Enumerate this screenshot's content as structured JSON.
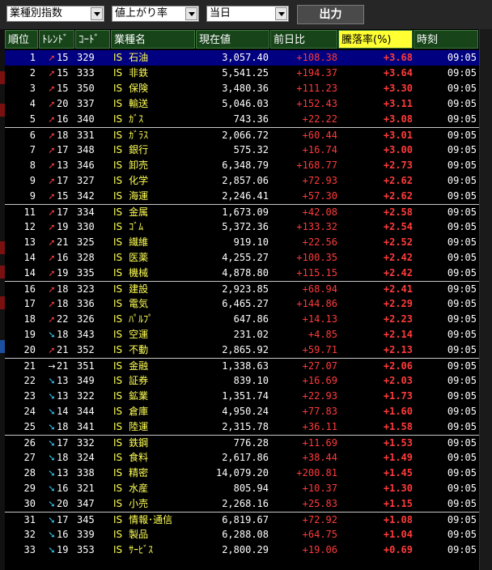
{
  "toolbar": {
    "category_select": "業種別指数",
    "sort_select": "値上がり率",
    "period_select": "当日",
    "output_button": "出力"
  },
  "columns": [
    "順位",
    "ﾄﾚﾝﾄﾞ",
    "ｺｰﾄﾞ",
    "業種名",
    "現在値",
    "前日比",
    "騰落率(%)",
    "時刻"
  ],
  "active_column": "騰落率(%)",
  "rows": [
    {
      "rank": "1",
      "trend_dir": "up",
      "trend": "15",
      "code": "329",
      "market": "IS",
      "name": "石油",
      "price": "3,057.40",
      "change": "+108.38",
      "rate": "+3.68",
      "time": "09:05"
    },
    {
      "rank": "2",
      "trend_dir": "up",
      "trend": "15",
      "code": "333",
      "market": "IS",
      "name": "非鉄",
      "price": "5,541.25",
      "change": "+194.37",
      "rate": "+3.64",
      "time": "09:05"
    },
    {
      "rank": "3",
      "trend_dir": "up",
      "trend": "15",
      "code": "350",
      "market": "IS",
      "name": "保険",
      "price": "3,480.36",
      "change": "+111.23",
      "rate": "+3.30",
      "time": "09:05"
    },
    {
      "rank": "4",
      "trend_dir": "up",
      "trend": "20",
      "code": "337",
      "market": "IS",
      "name": "輸送",
      "price": "5,046.03",
      "change": "+152.43",
      "rate": "+3.11",
      "time": "09:05"
    },
    {
      "rank": "5",
      "trend_dir": "up",
      "trend": "16",
      "code": "340",
      "market": "IS",
      "name": "ｶﾞｽ",
      "price": "743.36",
      "change": "+22.22",
      "rate": "+3.08",
      "time": "09:05"
    },
    {
      "rank": "6",
      "trend_dir": "up",
      "trend": "18",
      "code": "331",
      "market": "IS",
      "name": "ｶﾞﾗｽ",
      "price": "2,066.72",
      "change": "+60.44",
      "rate": "+3.01",
      "time": "09:05"
    },
    {
      "rank": "7",
      "trend_dir": "up",
      "trend": "17",
      "code": "348",
      "market": "IS",
      "name": "銀行",
      "price": "575.32",
      "change": "+16.74",
      "rate": "+3.00",
      "time": "09:05"
    },
    {
      "rank": "8",
      "trend_dir": "up",
      "trend": "13",
      "code": "346",
      "market": "IS",
      "name": "卸売",
      "price": "6,348.79",
      "change": "+168.77",
      "rate": "+2.73",
      "time": "09:05"
    },
    {
      "rank": "9",
      "trend_dir": "up",
      "trend": "17",
      "code": "327",
      "market": "IS",
      "name": "化学",
      "price": "2,857.06",
      "change": "+72.93",
      "rate": "+2.62",
      "time": "09:05"
    },
    {
      "rank": "9",
      "trend_dir": "up",
      "trend": "15",
      "code": "342",
      "market": "IS",
      "name": "海運",
      "price": "2,246.41",
      "change": "+57.30",
      "rate": "+2.62",
      "time": "09:05"
    },
    {
      "rank": "11",
      "trend_dir": "up",
      "trend": "17",
      "code": "334",
      "market": "IS",
      "name": "金属",
      "price": "1,673.09",
      "change": "+42.08",
      "rate": "+2.58",
      "time": "09:05"
    },
    {
      "rank": "12",
      "trend_dir": "up",
      "trend": "19",
      "code": "330",
      "market": "IS",
      "name": "ｺﾞﾑ",
      "price": "5,372.36",
      "change": "+133.32",
      "rate": "+2.54",
      "time": "09:05"
    },
    {
      "rank": "13",
      "trend_dir": "up",
      "trend": "21",
      "code": "325",
      "market": "IS",
      "name": "繊維",
      "price": "919.10",
      "change": "+22.56",
      "rate": "+2.52",
      "time": "09:05"
    },
    {
      "rank": "14",
      "trend_dir": "up",
      "trend": "16",
      "code": "328",
      "market": "IS",
      "name": "医薬",
      "price": "4,255.27",
      "change": "+100.35",
      "rate": "+2.42",
      "time": "09:05"
    },
    {
      "rank": "14",
      "trend_dir": "up",
      "trend": "19",
      "code": "335",
      "market": "IS",
      "name": "機械",
      "price": "4,878.80",
      "change": "+115.15",
      "rate": "+2.42",
      "time": "09:05"
    },
    {
      "rank": "16",
      "trend_dir": "up",
      "trend": "18",
      "code": "323",
      "market": "IS",
      "name": "建設",
      "price": "2,923.85",
      "change": "+68.94",
      "rate": "+2.41",
      "time": "09:05"
    },
    {
      "rank": "17",
      "trend_dir": "up",
      "trend": "18",
      "code": "336",
      "market": "IS",
      "name": "電気",
      "price": "6,465.27",
      "change": "+144.86",
      "rate": "+2.29",
      "time": "09:05"
    },
    {
      "rank": "18",
      "trend_dir": "up",
      "trend": "22",
      "code": "326",
      "market": "IS",
      "name": "ﾊﾟﾙﾌﾟ",
      "price": "647.86",
      "change": "+14.13",
      "rate": "+2.23",
      "time": "09:05"
    },
    {
      "rank": "19",
      "trend_dir": "down",
      "trend": "18",
      "code": "343",
      "market": "IS",
      "name": "空運",
      "price": "231.02",
      "change": "+4.85",
      "rate": "+2.14",
      "time": "09:05"
    },
    {
      "rank": "20",
      "trend_dir": "up",
      "trend": "21",
      "code": "352",
      "market": "IS",
      "name": "不動",
      "price": "2,865.92",
      "change": "+59.71",
      "rate": "+2.13",
      "time": "09:05"
    },
    {
      "rank": "21",
      "trend_dir": "flat",
      "trend": "21",
      "code": "351",
      "market": "IS",
      "name": "金融",
      "price": "1,338.63",
      "change": "+27.07",
      "rate": "+2.06",
      "time": "09:05"
    },
    {
      "rank": "22",
      "trend_dir": "down",
      "trend": "13",
      "code": "349",
      "market": "IS",
      "name": "証券",
      "price": "839.10",
      "change": "+16.69",
      "rate": "+2.03",
      "time": "09:05"
    },
    {
      "rank": "23",
      "trend_dir": "down",
      "trend": "13",
      "code": "322",
      "market": "IS",
      "name": "鉱業",
      "price": "1,351.74",
      "change": "+22.93",
      "rate": "+1.73",
      "time": "09:05"
    },
    {
      "rank": "24",
      "trend_dir": "down",
      "trend": "14",
      "code": "344",
      "market": "IS",
      "name": "倉庫",
      "price": "4,950.24",
      "change": "+77.83",
      "rate": "+1.60",
      "time": "09:05"
    },
    {
      "rank": "25",
      "trend_dir": "down",
      "trend": "18",
      "code": "341",
      "market": "IS",
      "name": "陸運",
      "price": "2,315.78",
      "change": "+36.11",
      "rate": "+1.58",
      "time": "09:05"
    },
    {
      "rank": "26",
      "trend_dir": "down",
      "trend": "17",
      "code": "332",
      "market": "IS",
      "name": "鉄鋼",
      "price": "776.28",
      "change": "+11.69",
      "rate": "+1.53",
      "time": "09:05"
    },
    {
      "rank": "27",
      "trend_dir": "down",
      "trend": "18",
      "code": "324",
      "market": "IS",
      "name": "食料",
      "price": "2,617.86",
      "change": "+38.44",
      "rate": "+1.49",
      "time": "09:05"
    },
    {
      "rank": "28",
      "trend_dir": "down",
      "trend": "13",
      "code": "338",
      "market": "IS",
      "name": "精密",
      "price": "14,079.20",
      "change": "+200.81",
      "rate": "+1.45",
      "time": "09:05"
    },
    {
      "rank": "29",
      "trend_dir": "down",
      "trend": "16",
      "code": "321",
      "market": "IS",
      "name": "水産",
      "price": "805.94",
      "change": "+10.37",
      "rate": "+1.30",
      "time": "09:05"
    },
    {
      "rank": "30",
      "trend_dir": "down",
      "trend": "20",
      "code": "347",
      "market": "IS",
      "name": "小売",
      "price": "2,268.16",
      "change": "+25.83",
      "rate": "+1.15",
      "time": "09:05"
    },
    {
      "rank": "31",
      "trend_dir": "down",
      "trend": "17",
      "code": "345",
      "market": "IS",
      "name": "情報･通信",
      "price": "6,819.67",
      "change": "+72.92",
      "rate": "+1.08",
      "time": "09:05"
    },
    {
      "rank": "32",
      "trend_dir": "down",
      "trend": "16",
      "code": "339",
      "market": "IS",
      "name": "製品",
      "price": "6,288.08",
      "change": "+64.75",
      "rate": "+1.04",
      "time": "09:05"
    },
    {
      "rank": "33",
      "trend_dir": "down",
      "trend": "19",
      "code": "353",
      "market": "IS",
      "name": "ｻｰﾋﾞｽ",
      "price": "2,800.29",
      "change": "+19.06",
      "rate": "+0.69",
      "time": "09:05"
    }
  ],
  "colors": {
    "header_bg": "#174419",
    "active_header_bg": "#ffff33",
    "selected_row_bg": "#000080",
    "positive": "#ff3b3b",
    "name": "#ffff55",
    "down_arrow": "#33ccff"
  },
  "icons": {
    "up": "up-right-arrow-icon",
    "down": "down-right-arrow-icon",
    "flat": "right-arrow-icon"
  }
}
